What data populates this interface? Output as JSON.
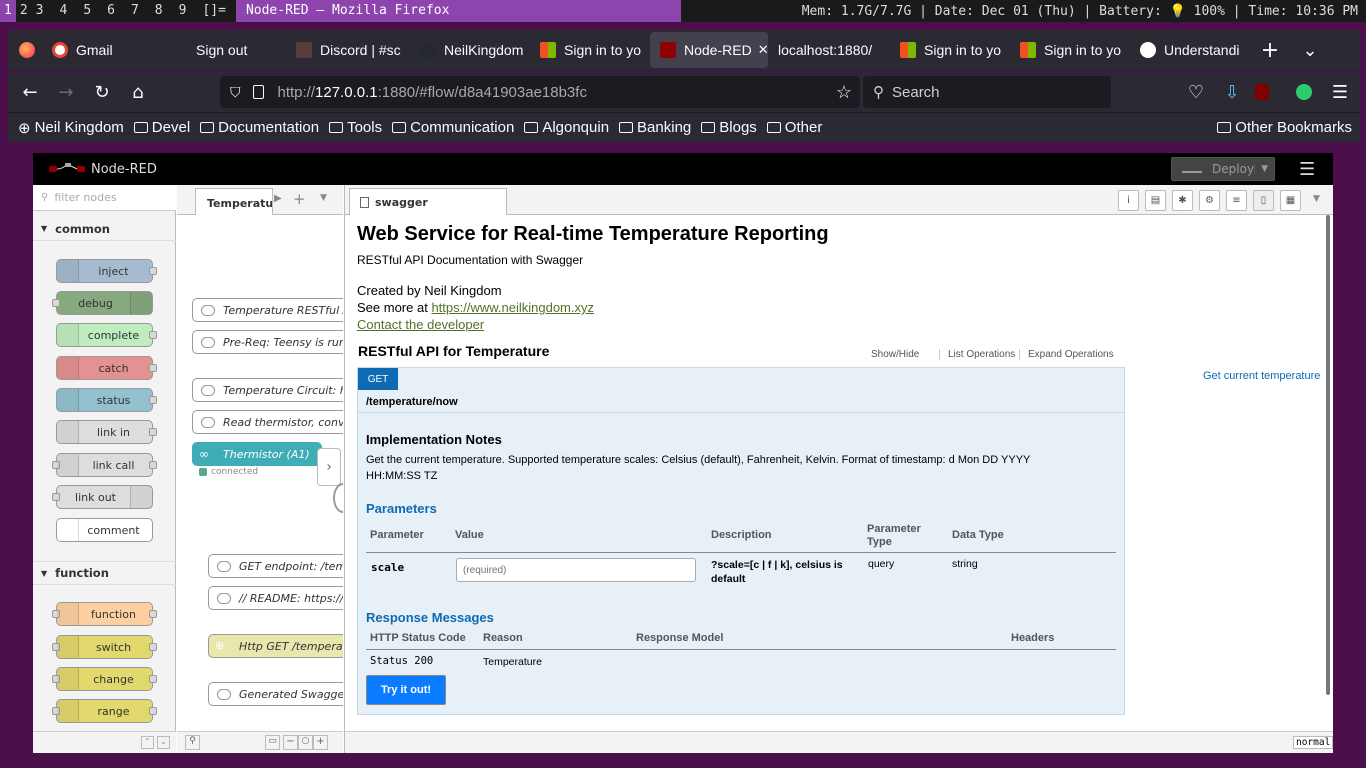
{
  "wm": {
    "workspaces": [
      "1",
      "2",
      "3",
      "4",
      "5",
      "6",
      "7",
      "8",
      "9"
    ],
    "layout": "[]=",
    "window_title": "Node-RED — Mozilla Firefox",
    "mem": "Mem: 1.7G/7.7G",
    "date": "Date: Dec 01 (Thu)",
    "battery": "Battery: 💡 100%",
    "time": "Time: 10:36 PM"
  },
  "tabs": [
    {
      "label": "Gmail",
      "color": "#ea4335"
    },
    {
      "label": "Sign out",
      "color": ""
    },
    {
      "label": "Discord | #sc",
      "color": "#5a3a3a"
    },
    {
      "label": "NeilKingdom",
      "color": "#24292f"
    },
    {
      "label": "Sign in to yo",
      "color": "#f25022"
    },
    {
      "label": "Node-RED",
      "color": "#8f0000"
    },
    {
      "label": "localhost:1880/",
      "color": ""
    },
    {
      "label": "Sign in to yo",
      "color": "#f25022"
    },
    {
      "label": "Sign in to yo",
      "color": "#f25022"
    },
    {
      "label": "Understandi",
      "color": "#cccccc"
    }
  ],
  "url": {
    "scheme": "http://",
    "host": "127.0.0.1",
    "rest": ":1880/#flow/d8a41903ae18b3fc"
  },
  "search_placeholder": "Search",
  "bookmarks": [
    "Neil Kingdom",
    "Devel",
    "Documentation",
    "Tools",
    "Communication",
    "Algonquin",
    "Banking",
    "Blogs",
    "Other"
  ],
  "other_bookmarks": "Other Bookmarks",
  "nodered": {
    "title": "Node-RED",
    "deploy": "Deploy",
    "filter_placeholder": "filter nodes",
    "categories": [
      "common",
      "function"
    ],
    "common_nodes": [
      "inject",
      "debug",
      "complete",
      "catch",
      "status",
      "link in",
      "link call",
      "link out",
      "comment"
    ],
    "function_nodes": [
      "function",
      "switch",
      "change",
      "range"
    ],
    "flow_tab": "Temperature",
    "flow_nodes": [
      "Temperature RESTful A",
      "Pre-Req: Teensy is run",
      "Temperature Circuit: ht",
      "Read thermistor, conve",
      "Thermistor (A1)",
      "GET endpoint: /tem",
      "// README: https://",
      "Http GET /temperat",
      "Generated Swagger"
    ],
    "connected": "connected",
    "sidebar_tab": "swagger",
    "mode": "normal"
  },
  "swagger": {
    "title": "Web Service for Real-time Temperature Reporting",
    "subtitle": "RESTful API Documentation with Swagger",
    "created_by": "Created by Neil Kingdom",
    "see_more": "See more at ",
    "site_link": "https://www.neilkingdom.xyz",
    "contact": "Contact the developer",
    "section": "RESTful API for Temperature",
    "show_hide": "Show/Hide",
    "list_ops": "List Operations",
    "expand_ops": "Expand Operations",
    "method": "GET",
    "path": "/temperature/now",
    "summary": "Get current temperature",
    "impl_title": "Implementation Notes",
    "impl_text": "Get the current temperature. Supported temperature scales: Celsius (default), Fahrenheit, Kelvin. Format of timestamp: d Mon DD YYYY HH:MM:SS TZ",
    "params_title": "Parameters",
    "param_headers": [
      "Parameter",
      "Value",
      "Description",
      "Parameter Type",
      "Data Type"
    ],
    "param": {
      "name": "scale",
      "placeholder": "(required)",
      "desc": "?scale=[c | f | k], celsius is default",
      "type": "query",
      "dtype": "string"
    },
    "resp_title": "Response Messages",
    "resp_headers": [
      "HTTP Status Code",
      "Reason",
      "Response Model",
      "Headers"
    ],
    "resp": {
      "code": "Status 200",
      "reason": "Temperature"
    },
    "try": "Try it out!"
  }
}
